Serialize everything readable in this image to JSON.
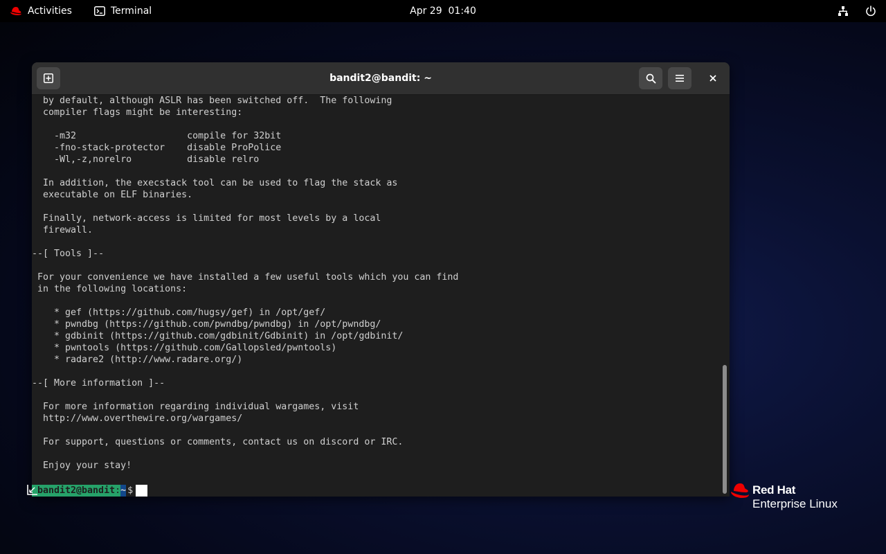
{
  "topbar": {
    "activities_label": "Activities",
    "app_label": "Terminal",
    "clock": "Apr 29  01:40",
    "network_icon": "network-icon",
    "power_icon": "power-icon"
  },
  "window": {
    "title": "bandit2@bandit: ~",
    "new_tab_icon": "new-tab-icon",
    "search_icon": "search-icon",
    "menu_icon": "hamburger-menu-icon",
    "close_icon": "close-icon"
  },
  "terminal": {
    "lines": [
      "  by default, although ASLR has been switched off.  The following",
      "  compiler flags might be interesting:",
      "",
      "    -m32                    compile for 32bit",
      "    -fno-stack-protector    disable ProPolice",
      "    -Wl,-z,norelro          disable relro",
      "",
      "  In addition, the execstack tool can be used to flag the stack as",
      "  executable on ELF binaries.",
      "",
      "  Finally, network-access is limited for most levels by a local",
      "  firewall.",
      "",
      "--[ Tools ]--",
      "",
      " For your convenience we have installed a few useful tools which you can find",
      " in the following locations:",
      "",
      "    * gef (https://github.com/hugsy/gef) in /opt/gef/",
      "    * pwndbg (https://github.com/pwndbg/pwndbg) in /opt/pwndbg/",
      "    * gdbinit (https://github.com/gdbinit/Gdbinit) in /opt/gdbinit/",
      "    * pwntools (https://github.com/Gallopsled/pwntools)",
      "    * radare2 (http://www.radare.org/)",
      "",
      "--[ More information ]--",
      "",
      "  For more information regarding individual wargames, visit",
      "  http://www.overthewire.org/wargames/",
      "",
      "  For support, questions or comments, contact us on discord or IRC.",
      "",
      "  Enjoy your stay!",
      ""
    ],
    "prompt": {
      "user_host": "bandit2@bandit",
      "colon": ":",
      "path": "~",
      "dollar": "$"
    }
  },
  "branding": {
    "line1": "Red Hat",
    "line2": "Enterprise Linux"
  },
  "colors": {
    "prompt_user": "#26a269",
    "prompt_path": "#12488b",
    "redhat_red": "#ee0000",
    "terminal_bg": "#1e1e1e"
  }
}
